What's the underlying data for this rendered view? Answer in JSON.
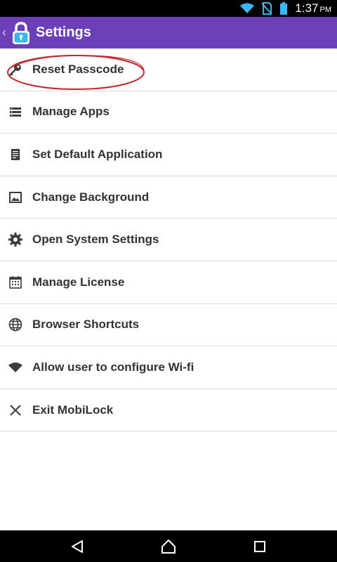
{
  "status_bar": {
    "time": "1:37",
    "ampm": "PM",
    "icons": [
      "wifi-icon",
      "no-sim-icon",
      "battery-icon"
    ]
  },
  "app_bar": {
    "title": "Settings",
    "back_icon": "chevron-left-icon",
    "logo_icon": "padlock-logo-icon",
    "color": "#6b3fb8"
  },
  "settings": {
    "items": [
      {
        "label": "Reset Passcode",
        "icon": "key-icon",
        "highlighted": true
      },
      {
        "label": "Manage Apps",
        "icon": "list-icon"
      },
      {
        "label": "Set Default Application",
        "icon": "document-icon"
      },
      {
        "label": "Change Background",
        "icon": "image-icon"
      },
      {
        "label": "Open System Settings",
        "icon": "gear-icon"
      },
      {
        "label": "Manage License",
        "icon": "calendar-icon"
      },
      {
        "label": "Browser Shortcuts",
        "icon": "globe-icon"
      },
      {
        "label": "Allow user to configure Wi-fi",
        "icon": "wifi-icon"
      },
      {
        "label": "Exit MobiLock",
        "icon": "close-icon"
      }
    ],
    "highlight_color": "#c0272d"
  },
  "nav_bar": {
    "buttons": [
      "back-icon",
      "home-icon",
      "recents-icon"
    ]
  }
}
